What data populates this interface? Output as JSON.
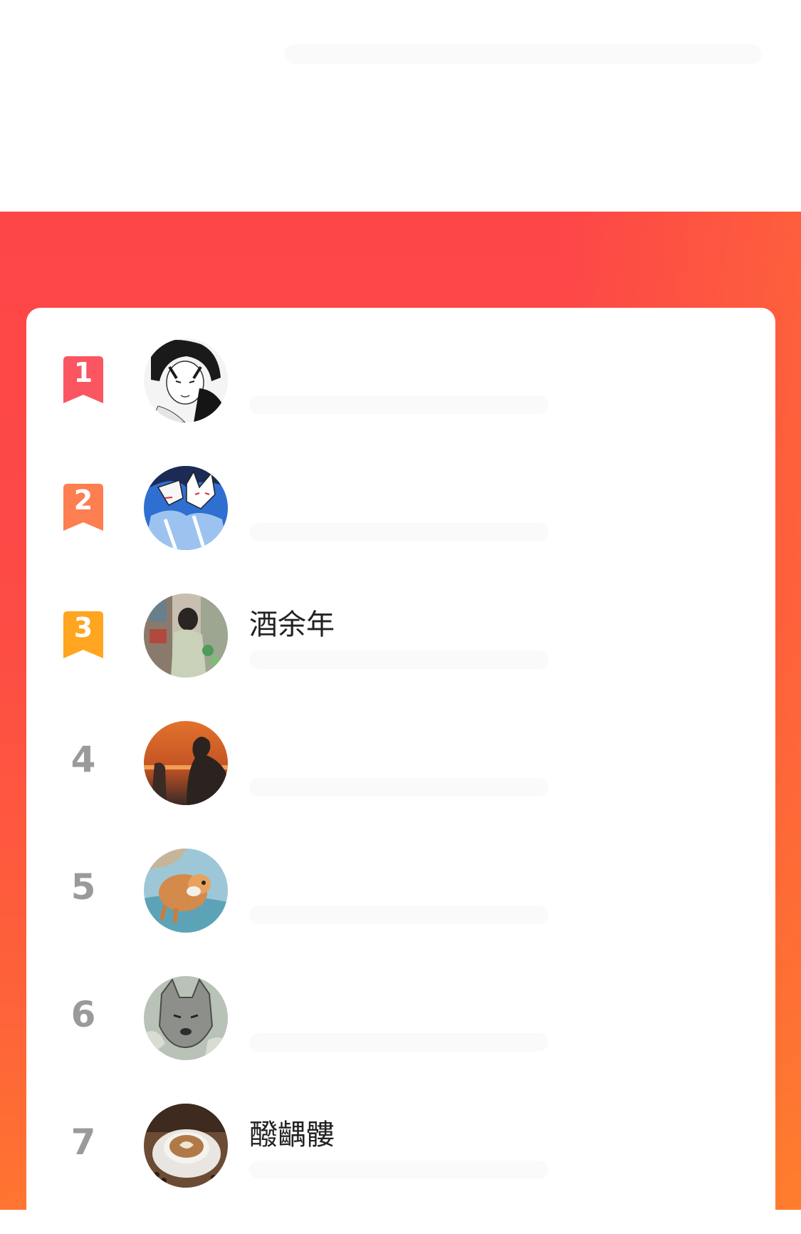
{
  "colors": {
    "panel_top": "#fd4648",
    "panel_bottom": "#ff7530",
    "badge_1": "#fb5562",
    "badge_2": "#fd7e50",
    "badge_3": "#ffa51f",
    "rank_gray": "#9a9a9a",
    "name_text": "#222222"
  },
  "ranking": [
    {
      "rank": "1",
      "badge": "ribbon",
      "name": "",
      "avatar_icon": "manga-boy-avatar-icon"
    },
    {
      "rank": "2",
      "badge": "ribbon",
      "name": "",
      "avatar_icon": "fox-mask-avatar-icon"
    },
    {
      "rank": "3",
      "badge": "ribbon",
      "name": "酒余年",
      "avatar_icon": "anime-street-avatar-icon"
    },
    {
      "rank": "4",
      "badge": "plain",
      "name": "",
      "avatar_icon": "sunset-silhouette-avatar-icon"
    },
    {
      "rank": "5",
      "badge": "plain",
      "name": "",
      "avatar_icon": "puppy-avatar-icon"
    },
    {
      "rank": "6",
      "badge": "plain",
      "name": "",
      "avatar_icon": "wolf-avatar-icon"
    },
    {
      "rank": "7",
      "badge": "plain",
      "name": "醱齵髏",
      "avatar_icon": "coffee-cup-avatar-icon"
    }
  ]
}
